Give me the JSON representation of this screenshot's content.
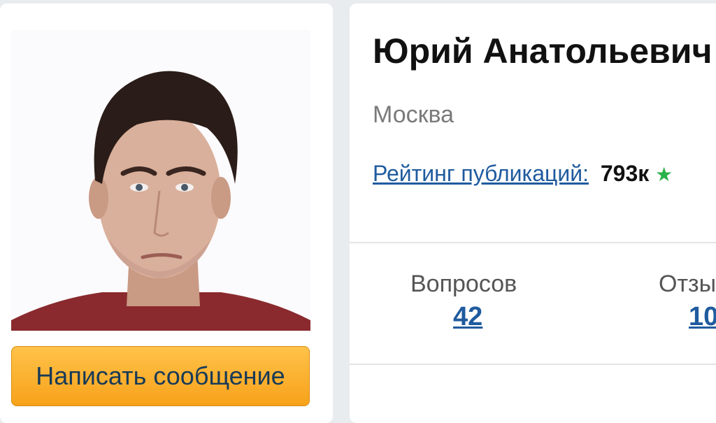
{
  "profile": {
    "name": "Юрий Анатольевич",
    "city": "Москва",
    "avatar_icon": "person-photo"
  },
  "rating": {
    "label": "Рейтинг публикаций:",
    "value": "793к",
    "icon": "star-icon",
    "icon_glyph": "★"
  },
  "actions": {
    "message_label": "Написать сообщение"
  },
  "stats": [
    {
      "label": "Вопросов",
      "value": "42"
    },
    {
      "label": "Отзы",
      "value": "10"
    }
  ],
  "colors": {
    "accent_link": "#1f5b9e",
    "button": "#f7a21a",
    "star": "#2ab24a"
  }
}
